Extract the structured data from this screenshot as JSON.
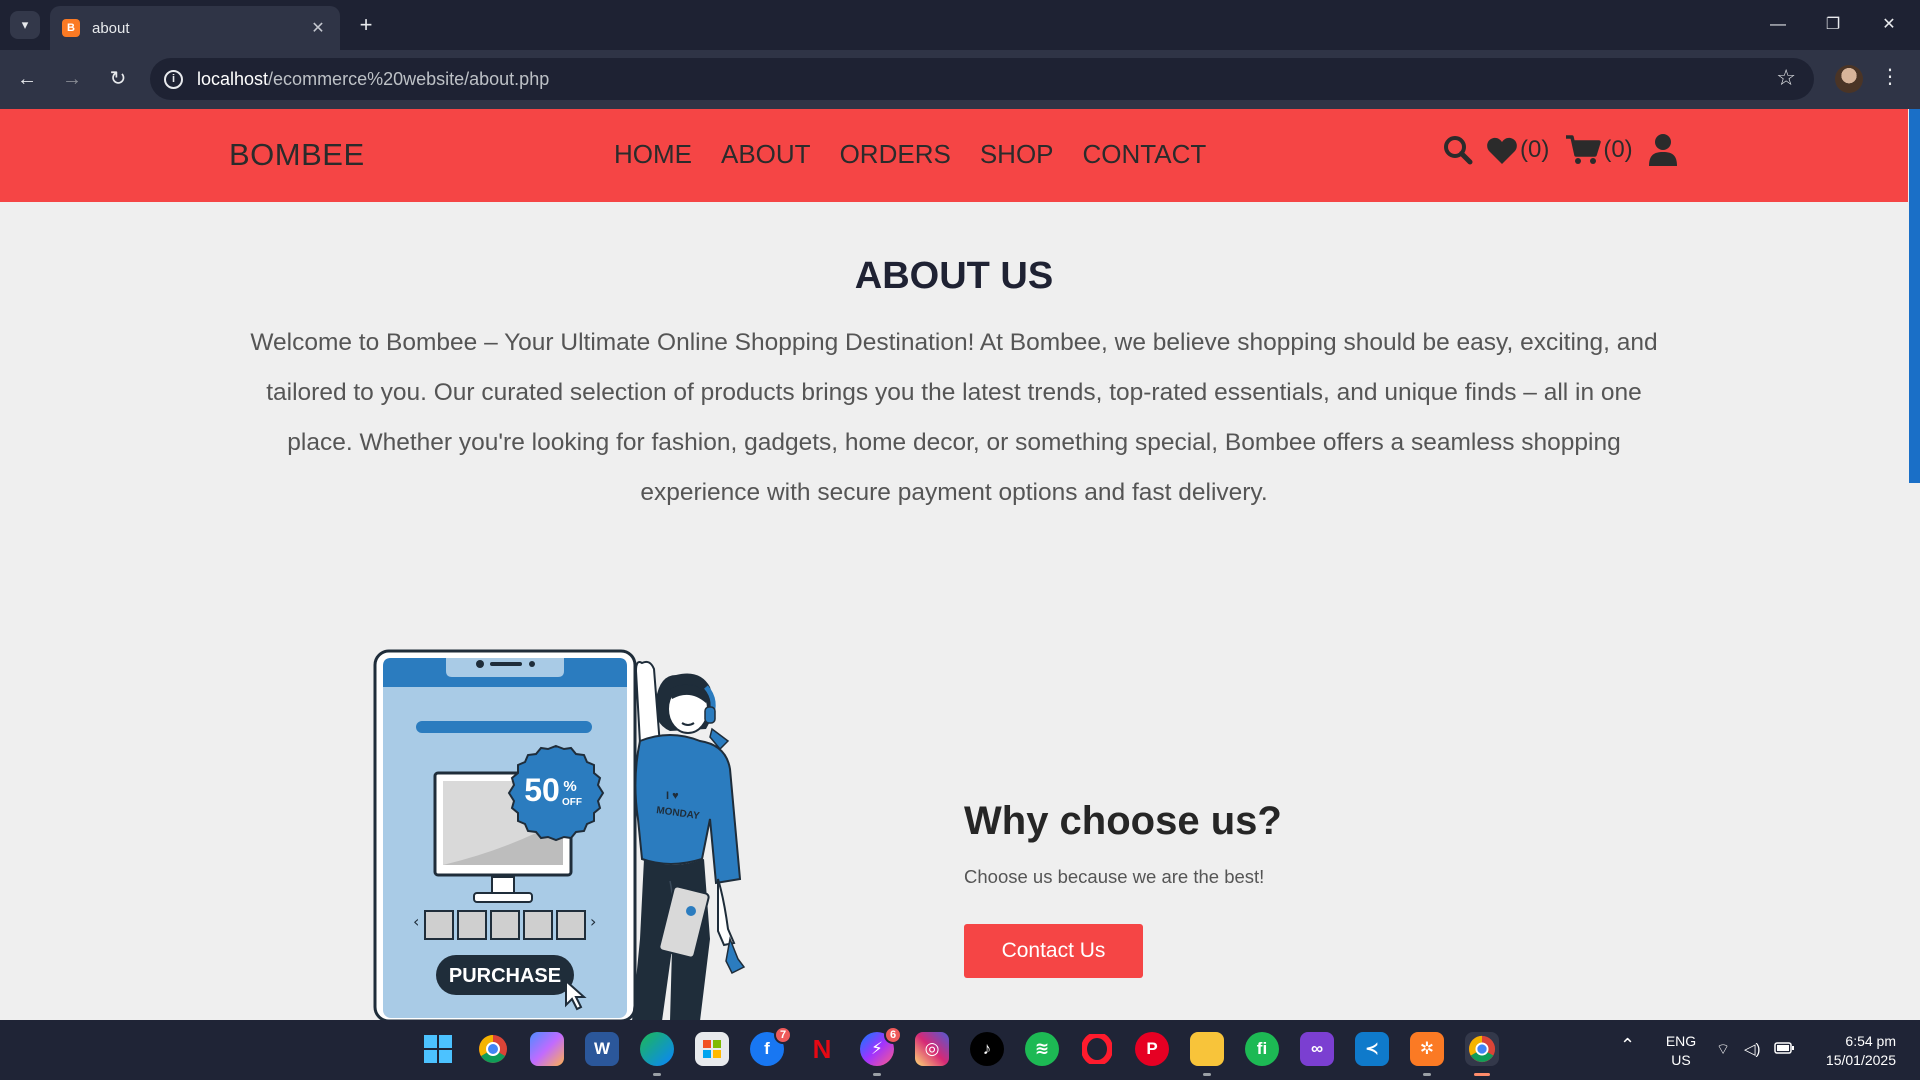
{
  "browser": {
    "tab": {
      "title": "about",
      "favicon_letter": "B"
    },
    "url": {
      "host": "localhost",
      "path": "/ecommerce%20website/about.php"
    }
  },
  "site": {
    "brand": "BOMBEE",
    "nav": [
      "HOME",
      "ABOUT",
      "ORDERS",
      "SHOP",
      "CONTACT"
    ],
    "wishlist_count": "(0)",
    "cart_count": "(0)"
  },
  "about": {
    "title": "ABOUT US",
    "text": "Welcome to Bombee – Your Ultimate Online Shopping Destination! At Bombee, we believe shopping should be easy, exciting, and tailored to you. Our curated selection of products brings you the latest trends, top-rated essentials, and unique finds – all in one place. Whether you're looking for fashion, gadgets, home decor, or something special, Bombee offers a seamless shopping experience with secure payment options and fast delivery."
  },
  "illustration": {
    "discount_big": "50",
    "discount_pct": "%",
    "discount_off": "OFF",
    "purchase_label": "PURCHASE",
    "shirt_line1": "I ♥",
    "shirt_line2": "MONDAY"
  },
  "why": {
    "title": "Why choose us?",
    "subtitle": "Choose us because we are the best!",
    "button": "Contact Us"
  },
  "taskbar": {
    "facebook_badge": "7",
    "messenger_badge": "6",
    "lang_line1": "ENG",
    "lang_line2": "US",
    "time": "6:54 pm",
    "date": "15/01/2025"
  },
  "colors": {
    "accent_red": "#f54545",
    "scroll_blue": "#1a6fc7",
    "illustration_blue": "#2b7cbf"
  }
}
